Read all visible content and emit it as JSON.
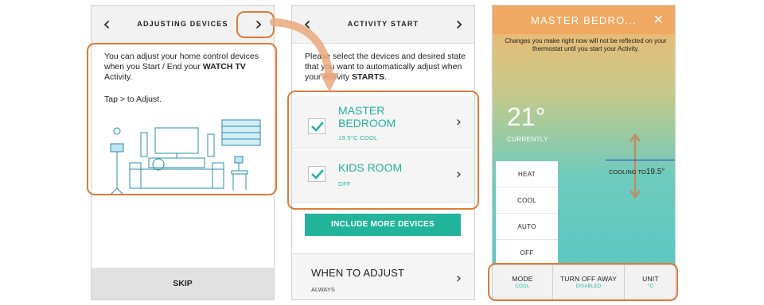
{
  "panel1": {
    "title": "ADJUSTING DEVICES",
    "back_icon": "chevron-left-icon",
    "next_icon": "chevron-right-icon",
    "back_glyph": "‹",
    "next_glyph": "›",
    "intro_part1": "You can adjust your home control devices when you Start / End your ",
    "intro_bold": "WATCH TV",
    "intro_part2": " Activity.",
    "tap_text": "Tap > to Adjust.",
    "skip_label": "SKIP"
  },
  "panel2": {
    "title": "ACTIVITY START",
    "instructions_part1": "Please select the devices and desired state that you want to automatically adjust when your Activity ",
    "instructions_bold": "STARTS",
    "instructions_part2": ".",
    "devices": [
      {
        "name_line1": "MASTER",
        "name_line2": "BEDROOM",
        "status": "19.5°C COOL",
        "checked": true
      },
      {
        "name_line1": "KIDS ROOM",
        "name_line2": "",
        "status": "OFF",
        "checked": true
      }
    ],
    "include_button": "INCLUDE MORE DEVICES",
    "when_title": "WHEN TO ADJUST",
    "when_value": "ALWAYS",
    "arrow_glyph": "›"
  },
  "panel3": {
    "title": "MASTER BEDRO...",
    "close_glyph": "✕",
    "notice": "Changes you make right now will not be reflected on your thermostat until you start your Activity.",
    "current_temp": "21°",
    "current_label": "CURRENTLY",
    "cooling_label": "COOLING TO",
    "cooling_value": "19.5°",
    "modes": [
      "HEAT",
      "COOL",
      "AUTO",
      "OFF"
    ],
    "bottom": [
      {
        "label": "MODE",
        "value": "COOL"
      },
      {
        "label": "TURN OFF AWAY",
        "value": "DISABLED"
      },
      {
        "label": "UNIT",
        "value": "°C"
      }
    ]
  },
  "colors": {
    "accent": "#22b39b",
    "highlight": "#e07a35",
    "header_orange": "#f0a862"
  }
}
